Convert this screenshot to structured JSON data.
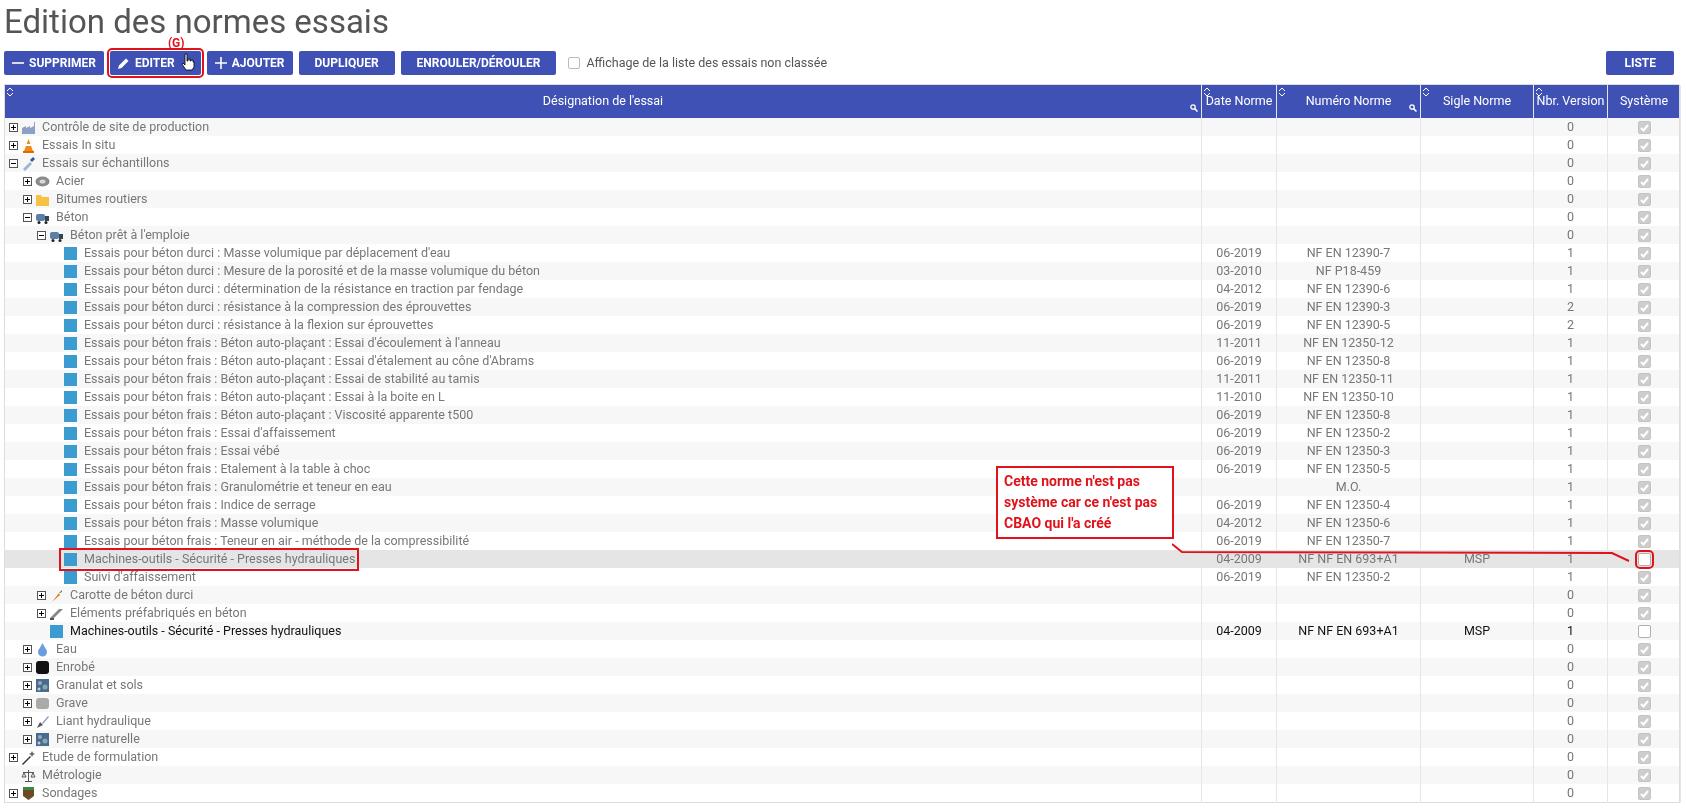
{
  "title": "Edition des normes essais",
  "toolbar": [
    {
      "kind": "minus",
      "label": "SUPPRIMER",
      "framed": false
    },
    {
      "kind": "pencil",
      "label": "EDITER",
      "framed": true,
      "note": "(G)"
    },
    {
      "kind": "plus",
      "label": "AJOUTER",
      "framed": false
    },
    {
      "kind": "plain",
      "label": "DUPLIQUER",
      "framed": false
    },
    {
      "kind": "plain",
      "label": "ENROULER/DÉROULER",
      "framed": false
    }
  ],
  "filter": {
    "label": "Affichage de la liste des essais non classée",
    "checked": false
  },
  "list_button": "LISTE",
  "columns": [
    {
      "label": "Désignation de l'essai",
      "sortable": true,
      "search": true
    },
    {
      "label": "Date Norme",
      "sortable": true,
      "search": false
    },
    {
      "label": "Numéro Norme",
      "sortable": true,
      "search": true
    },
    {
      "label": "Sigle Norme",
      "sortable": true,
      "search": false
    },
    {
      "label": "Nbr. Version",
      "sortable": true,
      "search": false
    },
    {
      "label": "Système",
      "sortable": false,
      "search": false
    }
  ],
  "tree": [
    {
      "kind": "factory",
      "label": "Contrôle de site de production",
      "expanded": false,
      "version": "0",
      "system": true,
      "selected": false
    },
    {
      "kind": "cone",
      "label": "Essais In situ",
      "expanded": false,
      "version": "0",
      "system": true,
      "selected": false
    },
    {
      "kind": "pipette",
      "label": "Essais sur échantillons",
      "expanded": true,
      "version": "0",
      "system": true,
      "selected": false,
      "children": [
        {
          "kind": "coil",
          "label": "Acier",
          "expanded": false,
          "version": "0",
          "system": true,
          "selected": false
        },
        {
          "kind": "folder",
          "label": "Bitumes routiers",
          "expanded": false,
          "version": "0",
          "system": true,
          "selected": false
        },
        {
          "kind": "mixer",
          "label": "Béton",
          "expanded": true,
          "version": "0",
          "system": true,
          "selected": false,
          "children": [
            {
              "kind": "mixer",
              "label": "Béton prêt à l'emploie",
              "expanded": true,
              "version": "0",
              "system": true,
              "selected": false,
              "children": [
                {
                  "kind": "norm",
                  "label": "Essais pour béton durci : Masse volumique par déplacement d'eau",
                  "date": "06-2019",
                  "number": "NF EN 12390-7",
                  "version": "1",
                  "system": true,
                  "selected": false
                },
                {
                  "kind": "norm",
                  "label": "Essais pour béton durci : Mesure de la porosité et de la masse volumique du béton",
                  "date": "03-2010",
                  "number": "NF P18-459",
                  "version": "1",
                  "system": true,
                  "selected": false
                },
                {
                  "kind": "norm",
                  "label": "Essais pour béton durci : détermination de la résistance en traction par fendage",
                  "date": "04-2012",
                  "number": "NF EN 12390-6",
                  "version": "1",
                  "system": true,
                  "selected": false
                },
                {
                  "kind": "norm",
                  "label": "Essais pour béton durci : résistance à la compression des éprouvettes",
                  "date": "06-2019",
                  "number": "NF EN 12390-3",
                  "version": "2",
                  "system": true,
                  "selected": false
                },
                {
                  "kind": "norm",
                  "label": "Essais pour béton durci : résistance à la flexion sur éprouvettes",
                  "date": "06-2019",
                  "number": "NF EN 12390-5",
                  "version": "2",
                  "system": true,
                  "selected": false
                },
                {
                  "kind": "norm",
                  "label": "Essais pour béton frais : Béton auto-plaçant : Essai d'écoulement à l'anneau",
                  "date": "11-2011",
                  "number": "NF EN 12350-12",
                  "version": "1",
                  "system": true,
                  "selected": false
                },
                {
                  "kind": "norm",
                  "label": "Essais pour béton frais : Béton auto-plaçant : Essai d'étalement au cône d'Abrams",
                  "date": "06-2019",
                  "number": "NF EN 12350-8",
                  "version": "1",
                  "system": true,
                  "selected": false
                },
                {
                  "kind": "norm",
                  "label": "Essais pour béton frais : Béton auto-plaçant : Essai de stabilité au tamis",
                  "date": "11-2011",
                  "number": "NF EN 12350-11",
                  "version": "1",
                  "system": true,
                  "selected": false
                },
                {
                  "kind": "norm",
                  "label": "Essais pour béton frais : Béton auto-plaçant : Essai à la boite en L",
                  "date": "11-2010",
                  "number": "NF EN 12350-10",
                  "version": "1",
                  "system": true,
                  "selected": false
                },
                {
                  "kind": "norm",
                  "label": "Essais pour béton frais : Béton auto-plaçant : Viscosité apparente t500",
                  "date": "06-2019",
                  "number": "NF EN 12350-8",
                  "version": "1",
                  "system": true,
                  "selected": false
                },
                {
                  "kind": "norm",
                  "label": "Essais pour béton frais : Essai d'affaissement",
                  "date": "06-2019",
                  "number": "NF EN 12350-2",
                  "version": "1",
                  "system": true,
                  "selected": false
                },
                {
                  "kind": "norm",
                  "label": "Essais pour béton frais : Essai vébé",
                  "date": "06-2019",
                  "number": "NF EN 12350-3",
                  "version": "1",
                  "system": true,
                  "selected": false
                },
                {
                  "kind": "norm",
                  "label": "Essais pour béton frais : Etalement à la table à choc",
                  "date": "06-2019",
                  "number": "NF EN 12350-5",
                  "version": "1",
                  "system": true,
                  "selected": false
                },
                {
                  "kind": "norm",
                  "label": "Essais pour béton frais : Granulométrie et teneur en eau",
                  "number": "M.O.",
                  "version": "1",
                  "system": true,
                  "selected": false
                },
                {
                  "kind": "norm",
                  "label": "Essais pour béton frais : Indice de serrage",
                  "date": "06-2019",
                  "number": "NF EN 12350-4",
                  "version": "1",
                  "system": true,
                  "selected": false
                },
                {
                  "kind": "norm",
                  "label": "Essais pour béton frais : Masse volumique",
                  "date": "04-2012",
                  "number": "NF EN 12350-6",
                  "version": "1",
                  "system": true,
                  "selected": false
                },
                {
                  "kind": "norm",
                  "label": "Essais pour béton frais : Teneur en air - méthode de la compressibilité",
                  "date": "06-2019",
                  "number": "NF EN 12350-7",
                  "version": "1",
                  "system": true,
                  "selected": false
                },
                {
                  "kind": "norm",
                  "label": "Machines-outils - Sécurité - Presses hydrauliques",
                  "date": "04-2009",
                  "number": "NF NF EN 693+A1",
                  "code": "MSP",
                  "version": "1",
                  "system": false,
                  "selected": true,
                  "framed": true
                },
                {
                  "kind": "norm",
                  "label": "Suivi d'affaissement",
                  "date": "06-2019",
                  "number": "NF EN 12350-2",
                  "version": "1",
                  "system": true,
                  "selected": false
                }
              ]
            },
            {
              "kind": "carrot",
              "label": "Carotte de béton durci",
              "expanded": false,
              "version": "0",
              "system": true,
              "selected": false
            },
            {
              "kind": "beam",
              "label": "Eléments préfabriqués en béton",
              "expanded": false,
              "version": "0",
              "system": true,
              "selected": false
            },
            {
              "kind": "norm",
              "label": "Machines-outils - Sécurité - Presses hydrauliques",
              "date": "04-2009",
              "number": "NF NF EN 693+A1",
              "code": "MSP",
              "version": "1",
              "system": false,
              "selected": false,
              "dark": true
            }
          ]
        },
        {
          "kind": "drop",
          "label": "Eau",
          "expanded": false,
          "version": "0",
          "system": true,
          "selected": false
        },
        {
          "kind": "asphalt",
          "label": "Enrobé",
          "expanded": false,
          "version": "0",
          "system": true,
          "selected": false
        },
        {
          "kind": "gravel",
          "label": "Granulat et sols",
          "expanded": false,
          "version": "0",
          "system": true,
          "selected": false
        },
        {
          "kind": "grave",
          "label": "Grave",
          "expanded": false,
          "version": "0",
          "system": true,
          "selected": false
        },
        {
          "kind": "trowel",
          "label": "Liant hydraulique",
          "expanded": false,
          "version": "0",
          "system": true,
          "selected": false
        },
        {
          "kind": "gravel",
          "label": "Pierre naturelle",
          "expanded": false,
          "version": "0",
          "system": true,
          "selected": false
        }
      ]
    },
    {
      "kind": "wand",
      "label": "Etude de formulation",
      "expanded": false,
      "version": "0",
      "system": true,
      "selected": false
    },
    {
      "kind": "scale",
      "label": "Métrologie",
      "version": "0",
      "system": true,
      "selected": false
    },
    {
      "kind": "soil",
      "label": "Sondages",
      "expanded": false,
      "version": "0",
      "system": true,
      "selected": false
    }
  ],
  "callout": "Cette norme n'est pas système car ce n'est pas CBAO qui l'a créé"
}
